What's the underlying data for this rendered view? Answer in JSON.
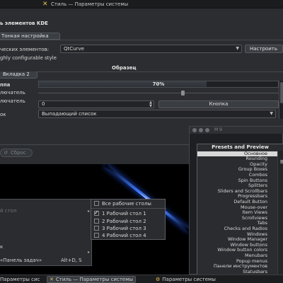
{
  "window": {
    "title": "Стиль — Параметры системы",
    "heading": "ь элементов KDE",
    "tab_fine": "Тонкая настройка",
    "style_label": "ческих элементов:",
    "style_value": "QtCurve",
    "configure_button": "Настроить",
    "description": "ghly configurable style",
    "preview_title": "Образец",
    "tab2": "Вкладка 2",
    "group_label": "ппа",
    "progress_percent": 70,
    "progress_text": "70%",
    "radio1": "лючатель",
    "radio2": "лючатель",
    "slider_value": 0.6,
    "spin_value": "0",
    "button_label": "Кнопка",
    "combo_label": "ок",
    "combo_value": "Выпадающий список",
    "reset_button": "Сброс"
  },
  "context_menu": {
    "items": [
      {
        "label": "й стол",
        "dim": true,
        "submenu": true
      },
      {
        "label": "к"
      },
      {
        "label": "«Панель задач»",
        "shortcut": "Alt+D, S",
        "submenu": true
      }
    ]
  },
  "desktops_submenu": {
    "all_label": "Все рабочие столы",
    "desktops": [
      {
        "label": "1 Рабочий стол 1",
        "checked": true
      },
      {
        "label": "2 Рабочий стол 2",
        "checked": false
      },
      {
        "label": "3 Рабочий стол 3",
        "checked": false
      },
      {
        "label": "4 Рабочий стол 4",
        "checked": false
      }
    ]
  },
  "presets": {
    "title_fragment": "M 9",
    "header": "Presets and Preview",
    "items": [
      "Основное",
      "Rounding",
      "Opacity",
      "Group Boxes",
      "Combos",
      "Spin Buttons",
      "Splitters",
      "Sliders and Scrollbars",
      "Progressbars",
      "Default Button",
      "Mouse-over",
      "Item Views",
      "Scrollviews",
      "Tabs",
      "Checks and Radios",
      "Windows",
      "Window Manager",
      "Window buttons",
      "Window button colors",
      "Menubars",
      "Popup menus",
      "Панели инструментов",
      "Statusbars",
      "Dock windows",
      "Advanced Settings",
      "Приложения",
      "Legacy"
    ],
    "selected_index": 0,
    "side_char": "В"
  },
  "taskbar": {
    "items": [
      {
        "label": "Параметры сис",
        "active": false
      },
      {
        "label": "Стиль — Параметры системы",
        "active": true
      },
      {
        "label": "Параметры системы",
        "active": false
      }
    ]
  },
  "colors": {
    "window_bg": "#2b2d30",
    "accent_blue": "#3c7cff",
    "selection": "#d8d8d8"
  }
}
